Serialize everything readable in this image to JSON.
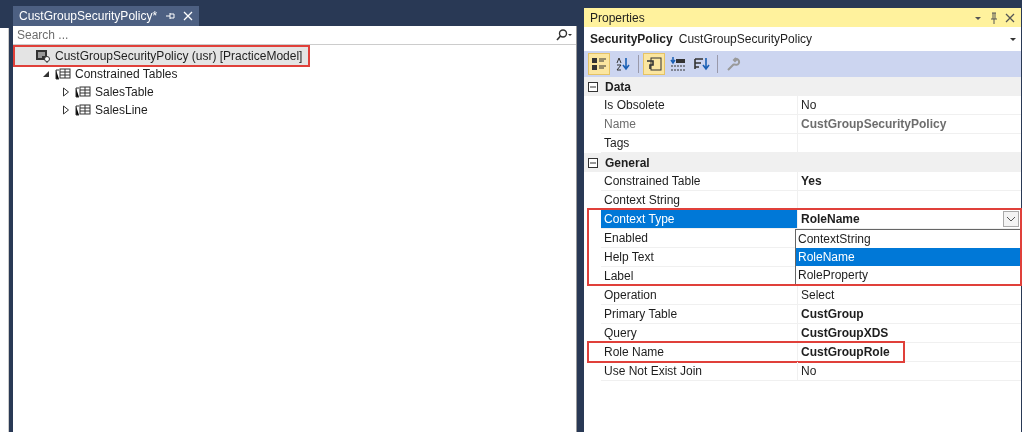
{
  "document_tab": {
    "title": "CustGroupSecurityPolicy*",
    "selected": true
  },
  "search": {
    "placeholder": "Search ..."
  },
  "tree": [
    {
      "label": "CustGroupSecurityPolicy (usr) [PracticeModel]",
      "kind": "policy",
      "selected": true,
      "highlighted": true,
      "children": [
        {
          "label": "Constrained Tables",
          "kind": "tables",
          "expanded": true,
          "selected": false,
          "children": [
            {
              "label": "SalesTable",
              "kind": "table",
              "expanded": false,
              "selected": false
            },
            {
              "label": "SalesLine",
              "kind": "table",
              "expanded": false,
              "selected": false
            }
          ]
        }
      ]
    }
  ],
  "properties": {
    "title": "Properties",
    "object_type": "SecurityPolicy",
    "object_name": "CustGroupSecurityPolicy",
    "toolbar": [
      {
        "kind": "categorized",
        "selected": true
      },
      {
        "kind": "alphabetical",
        "selected": false
      },
      {
        "kind": "properties",
        "selected": true
      },
      {
        "kind": "events",
        "selected": false
      },
      {
        "kind": "sort",
        "selected": false
      },
      {
        "kind": "wrench",
        "selected": false
      }
    ],
    "categories": [
      {
        "name": "Data",
        "expanded": true,
        "rows": [
          {
            "name": "Is Obsolete",
            "value": "No",
            "bold": false,
            "readonly": false
          },
          {
            "name": "Name",
            "value": "CustGroupSecurityPolicy",
            "bold": true,
            "readonly": true
          },
          {
            "name": "Tags"
          }
        ]
      },
      {
        "name": "General",
        "expanded": true,
        "rows": [
          {
            "name": "Constrained Table",
            "value": "Yes",
            "bold": true,
            "readonly": false
          },
          {
            "name": "Context String"
          },
          {
            "name": "Context Type",
            "value": "RoleName",
            "selected": true,
            "highlighted": true,
            "dropdown": [
              {
                "label": "ContextString",
                "selected": false
              },
              {
                "label": "RoleName",
                "selected": true
              },
              {
                "label": "RoleProperty",
                "selected": false
              }
            ]
          },
          {
            "name": "Enabled"
          },
          {
            "name": "Help Text"
          },
          {
            "name": "Label"
          },
          {
            "name": "Operation",
            "value": "Select",
            "bold": false,
            "readonly": false
          },
          {
            "name": "Primary Table",
            "value": "CustGroup",
            "bold": true,
            "readonly": false
          },
          {
            "name": "Query",
            "value": "CustGroupXDS",
            "bold": true,
            "readonly": false
          },
          {
            "name": "Role Name",
            "value": "CustGroupRole",
            "bold": true,
            "readonly": false,
            "highlighted": true
          },
          {
            "name": "Use Not Exist Join",
            "value": "No",
            "bold": false,
            "readonly": false
          }
        ]
      }
    ]
  }
}
